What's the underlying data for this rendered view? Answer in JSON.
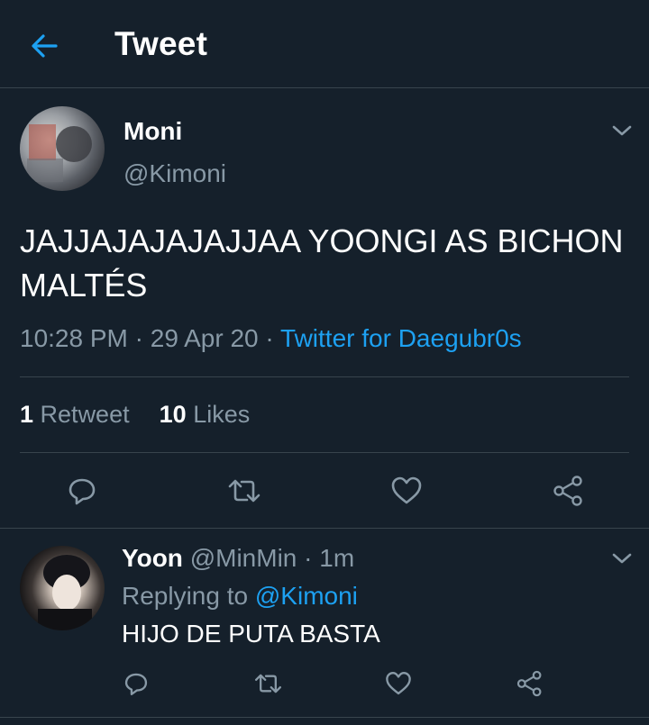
{
  "colors": {
    "background": "#15202b",
    "divider": "#38444d",
    "text_primary": "#ffffff",
    "text_secondary": "#8899a6",
    "accent": "#1da1f2"
  },
  "header": {
    "back_icon": "arrow-left-icon",
    "title": "Tweet"
  },
  "tweet": {
    "author": {
      "name": "Moni",
      "handle": "@Kimoni"
    },
    "more_icon": "chevron-down-icon",
    "text": "JAJJAJAJAJAJJAA YOONGI AS BICHON MALTÉS",
    "time": "10:28 PM",
    "separator": " · ",
    "date": "29 Apr 20",
    "source": "Twitter for Daegubr0s",
    "stats": {
      "retweets_count": "1",
      "retweets_label": "Retweet",
      "likes_count": "10",
      "likes_label": "Likes"
    },
    "actions": [
      "reply-icon",
      "retweet-icon",
      "like-icon",
      "share-icon"
    ]
  },
  "reply": {
    "author": {
      "name": "Yoon",
      "handle": "@MinMin"
    },
    "separator": " · ",
    "time_ago": "1m",
    "replying_to_label": "Replying to",
    "replying_to_handle": "@Kimoni",
    "text": "HIJO DE PUTA BASTA",
    "more_icon": "chevron-down-icon",
    "actions": [
      "reply-icon",
      "retweet-icon",
      "like-icon",
      "share-icon"
    ]
  }
}
